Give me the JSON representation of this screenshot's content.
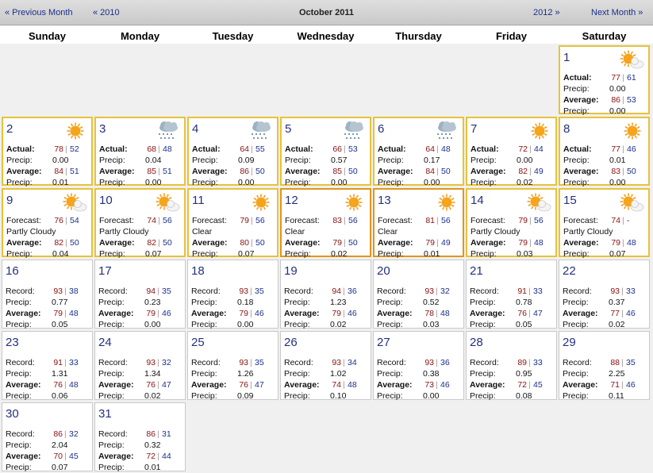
{
  "nav": {
    "prev_month": "« Previous Month",
    "prev_year": "« 2010",
    "title": "October 2011",
    "next_year": "2012 »",
    "next_month": "Next Month »"
  },
  "weekdays": [
    "Sunday",
    "Monday",
    "Tuesday",
    "Wednesday",
    "Thursday",
    "Friday",
    "Saturday"
  ],
  "colors": {
    "number": "#24307e",
    "high": "#8a1010",
    "low": "#1c2f8c",
    "past_border": "#e7c23a",
    "today_border": "#e09620"
  },
  "days": [
    {
      "day": "1",
      "icon": "partly-cloudy-icon",
      "kind": "past",
      "rows": [
        [
          "Actual:",
          "77",
          "61"
        ],
        [
          "Precip:",
          "0.00"
        ],
        [
          "Average:",
          "86",
          "53"
        ],
        [
          "Precip:",
          "0.00"
        ]
      ]
    },
    {
      "day": "2",
      "icon": "sun-icon",
      "kind": "past",
      "rows": [
        [
          "Actual:",
          "78",
          "52"
        ],
        [
          "Precip:",
          "0.00"
        ],
        [
          "Average:",
          "84",
          "51"
        ],
        [
          "Precip:",
          "0.01"
        ]
      ]
    },
    {
      "day": "3",
      "icon": "rain-icon",
      "kind": "past",
      "rows": [
        [
          "Actual:",
          "68",
          "48"
        ],
        [
          "Precip:",
          "0.04"
        ],
        [
          "Average:",
          "85",
          "51"
        ],
        [
          "Precip:",
          "0.00"
        ]
      ]
    },
    {
      "day": "4",
      "icon": "rain-icon",
      "kind": "past",
      "rows": [
        [
          "Actual:",
          "64",
          "55"
        ],
        [
          "Precip:",
          "0.09"
        ],
        [
          "Average:",
          "86",
          "50"
        ],
        [
          "Precip:",
          "0.00"
        ]
      ]
    },
    {
      "day": "5",
      "icon": "rain-icon",
      "kind": "past",
      "rows": [
        [
          "Actual:",
          "66",
          "53"
        ],
        [
          "Precip:",
          "0.57"
        ],
        [
          "Average:",
          "85",
          "50"
        ],
        [
          "Precip:",
          "0.00"
        ]
      ]
    },
    {
      "day": "6",
      "icon": "rain-icon",
      "kind": "past",
      "rows": [
        [
          "Actual:",
          "64",
          "48"
        ],
        [
          "Precip:",
          "0.17"
        ],
        [
          "Average:",
          "84",
          "50"
        ],
        [
          "Precip:",
          "0.00"
        ]
      ]
    },
    {
      "day": "7",
      "icon": "sun-icon",
      "kind": "past",
      "rows": [
        [
          "Actual:",
          "72",
          "44"
        ],
        [
          "Precip:",
          "0.00"
        ],
        [
          "Average:",
          "82",
          "49"
        ],
        [
          "Precip:",
          "0.02"
        ]
      ]
    },
    {
      "day": "8",
      "icon": "sun-icon",
      "kind": "past",
      "rows": [
        [
          "Actual:",
          "77",
          "46"
        ],
        [
          "Precip:",
          "0.01"
        ],
        [
          "Average:",
          "83",
          "50"
        ],
        [
          "Precip:",
          "0.00"
        ]
      ]
    },
    {
      "day": "9",
      "icon": "partly-cloudy-icon",
      "kind": "past",
      "rows": [
        [
          "Forecast:",
          "76",
          "54"
        ],
        [
          "Partly Cloudy"
        ],
        [
          "Average:",
          "82",
          "50"
        ],
        [
          "Precip:",
          "0.04"
        ]
      ]
    },
    {
      "day": "10",
      "icon": "partly-cloudy-icon",
      "kind": "past",
      "rows": [
        [
          "Forecast:",
          "74",
          "56"
        ],
        [
          "Partly Cloudy"
        ],
        [
          "Average:",
          "82",
          "50"
        ],
        [
          "Precip:",
          "0.07"
        ]
      ]
    },
    {
      "day": "11",
      "icon": "sun-icon",
      "kind": "past",
      "rows": [
        [
          "Forecast:",
          "79",
          "56"
        ],
        [
          "Clear"
        ],
        [
          "Average:",
          "80",
          "50"
        ],
        [
          "Precip:",
          "0.07"
        ]
      ]
    },
    {
      "day": "12",
      "icon": "sun-icon",
      "kind": "today",
      "rows": [
        [
          "Forecast:",
          "83",
          "56"
        ],
        [
          "Clear"
        ],
        [
          "Average:",
          "79",
          "50"
        ],
        [
          "Precip:",
          "0.02"
        ]
      ]
    },
    {
      "day": "13",
      "icon": "sun-icon",
      "kind": "today",
      "rows": [
        [
          "Forecast:",
          "81",
          "56"
        ],
        [
          "Clear"
        ],
        [
          "Average:",
          "79",
          "49"
        ],
        [
          "Precip:",
          "0.01"
        ]
      ]
    },
    {
      "day": "14",
      "icon": "partly-cloudy-icon",
      "kind": "past",
      "rows": [
        [
          "Forecast:",
          "79",
          "56"
        ],
        [
          "Partly Cloudy"
        ],
        [
          "Average:",
          "79",
          "48"
        ],
        [
          "Precip:",
          "0.03"
        ]
      ]
    },
    {
      "day": "15",
      "icon": "partly-cloudy-icon",
      "kind": "past",
      "rows": [
        [
          "Forecast:",
          "74",
          "-"
        ],
        [
          "Partly Cloudy"
        ],
        [
          "Average:",
          "79",
          "48"
        ],
        [
          "Precip:",
          "0.07"
        ]
      ]
    },
    {
      "day": "16",
      "kind": "future",
      "rows": [
        [
          "Record:",
          "93",
          "38"
        ],
        [
          "Precip:",
          "0.77"
        ],
        [
          "Average:",
          "79",
          "48"
        ],
        [
          "Precip:",
          "0.05"
        ]
      ]
    },
    {
      "day": "17",
      "kind": "future",
      "rows": [
        [
          "Record:",
          "94",
          "35"
        ],
        [
          "Precip:",
          "0.23"
        ],
        [
          "Average:",
          "79",
          "46"
        ],
        [
          "Precip:",
          "0.00"
        ]
      ]
    },
    {
      "day": "18",
      "kind": "future",
      "rows": [
        [
          "Record:",
          "93",
          "35"
        ],
        [
          "Precip:",
          "0.18"
        ],
        [
          "Average:",
          "79",
          "46"
        ],
        [
          "Precip:",
          "0.00"
        ]
      ]
    },
    {
      "day": "19",
      "kind": "future",
      "rows": [
        [
          "Record:",
          "94",
          "36"
        ],
        [
          "Precip:",
          "1.23"
        ],
        [
          "Average:",
          "79",
          "46"
        ],
        [
          "Precip:",
          "0.02"
        ]
      ]
    },
    {
      "day": "20",
      "kind": "future",
      "rows": [
        [
          "Record:",
          "93",
          "32"
        ],
        [
          "Precip:",
          "0.52"
        ],
        [
          "Average:",
          "78",
          "48"
        ],
        [
          "Precip:",
          "0.03"
        ]
      ]
    },
    {
      "day": "21",
      "kind": "future",
      "rows": [
        [
          "Record:",
          "91",
          "33"
        ],
        [
          "Precip:",
          "0.78"
        ],
        [
          "Average:",
          "76",
          "47"
        ],
        [
          "Precip:",
          "0.05"
        ]
      ]
    },
    {
      "day": "22",
      "kind": "future",
      "rows": [
        [
          "Record:",
          "93",
          "33"
        ],
        [
          "Precip:",
          "0.37"
        ],
        [
          "Average:",
          "77",
          "46"
        ],
        [
          "Precip:",
          "0.02"
        ]
      ]
    },
    {
      "day": "23",
      "kind": "future",
      "rows": [
        [
          "Record:",
          "91",
          "33"
        ],
        [
          "Precip:",
          "1.31"
        ],
        [
          "Average:",
          "76",
          "48"
        ],
        [
          "Precip:",
          "0.06"
        ]
      ]
    },
    {
      "day": "24",
      "kind": "future",
      "rows": [
        [
          "Record:",
          "93",
          "32"
        ],
        [
          "Precip:",
          "1.34"
        ],
        [
          "Average:",
          "76",
          "47"
        ],
        [
          "Precip:",
          "0.02"
        ]
      ]
    },
    {
      "day": "25",
      "kind": "future",
      "rows": [
        [
          "Record:",
          "93",
          "35"
        ],
        [
          "Precip:",
          "1.26"
        ],
        [
          "Average:",
          "76",
          "47"
        ],
        [
          "Precip:",
          "0.09"
        ]
      ]
    },
    {
      "day": "26",
      "kind": "future",
      "rows": [
        [
          "Record:",
          "93",
          "34"
        ],
        [
          "Precip:",
          "1.02"
        ],
        [
          "Average:",
          "74",
          "48"
        ],
        [
          "Precip:",
          "0.10"
        ]
      ]
    },
    {
      "day": "27",
      "kind": "future",
      "rows": [
        [
          "Record:",
          "93",
          "36"
        ],
        [
          "Precip:",
          "0.38"
        ],
        [
          "Average:",
          "73",
          "46"
        ],
        [
          "Precip:",
          "0.00"
        ]
      ]
    },
    {
      "day": "28",
      "kind": "future",
      "rows": [
        [
          "Record:",
          "89",
          "33"
        ],
        [
          "Precip:",
          "0.95"
        ],
        [
          "Average:",
          "72",
          "45"
        ],
        [
          "Precip:",
          "0.08"
        ]
      ]
    },
    {
      "day": "29",
      "kind": "future",
      "rows": [
        [
          "Record:",
          "88",
          "35"
        ],
        [
          "Precip:",
          "2.25"
        ],
        [
          "Average:",
          "71",
          "46"
        ],
        [
          "Precip:",
          "0.11"
        ]
      ]
    },
    {
      "day": "30",
      "kind": "future",
      "rows": [
        [
          "Record:",
          "86",
          "32"
        ],
        [
          "Precip:",
          "2.04"
        ],
        [
          "Average:",
          "70",
          "45"
        ],
        [
          "Precip:",
          "0.07"
        ]
      ]
    },
    {
      "day": "31",
      "kind": "future",
      "rows": [
        [
          "Record:",
          "86",
          "31"
        ],
        [
          "Precip:",
          "0.32"
        ],
        [
          "Average:",
          "72",
          "44"
        ],
        [
          "Precip:",
          "0.01"
        ]
      ]
    }
  ]
}
